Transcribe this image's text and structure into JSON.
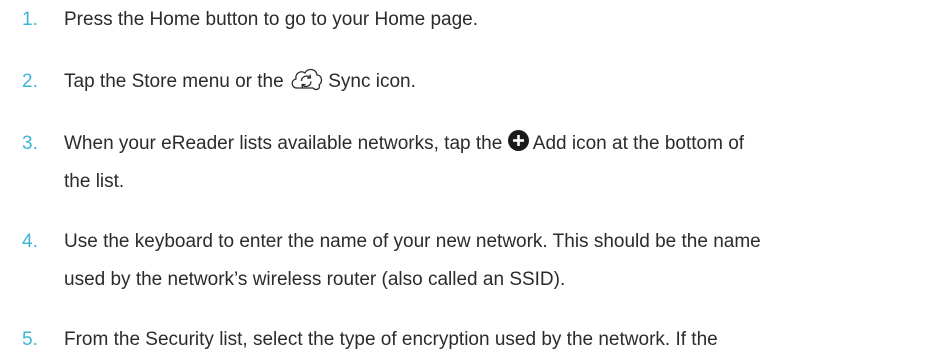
{
  "steps": [
    {
      "number": "1.",
      "text": "Press the Home button to go to your Home page."
    },
    {
      "number": "2.",
      "text_before": "Tap the Store menu or the",
      "icon": "sync-icon",
      "text_after": "Sync icon."
    },
    {
      "number": "3.",
      "text_before": "When your eReader lists available networks, tap the",
      "icon": "add-icon",
      "text_after": "Add icon at the bottom of",
      "text_line2": "the list."
    },
    {
      "number": "4.",
      "text_line1": "Use the keyboard to enter the name of your new network. This should be the name",
      "text_line2": "used by the network’s wireless router (also called an SSID)."
    },
    {
      "number": "5.",
      "text": "From the Security list, select the type of encryption used by the network. If the"
    }
  ],
  "colors": {
    "number": "#3fb3d6",
    "text": "#2b2b2b",
    "add_icon_fill": "#1a1a1a"
  }
}
